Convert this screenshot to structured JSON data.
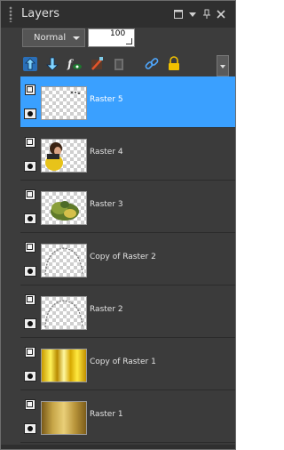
{
  "panel": {
    "title": "Layers"
  },
  "titlebar_icons": [
    "maximize-icon",
    "dropdown-icon",
    "pin-icon",
    "close-icon"
  ],
  "blend_mode": {
    "value": "Normal"
  },
  "opacity": {
    "value": "100"
  },
  "toolbar": {
    "tools": [
      "new-raster-layer-icon",
      "merge-down-icon",
      "fx-effects-icon",
      "edit-layer-icon",
      "mask-icon",
      "link-icon",
      "lock-icon"
    ]
  },
  "layers": [
    {
      "name": "Raster 5",
      "selected": true
    },
    {
      "name": "Raster 4",
      "selected": false
    },
    {
      "name": "Raster 3",
      "selected": false
    },
    {
      "name": "Copy of Raster 2",
      "selected": false
    },
    {
      "name": "Raster 2",
      "selected": false
    },
    {
      "name": "Copy of Raster 1",
      "selected": false
    },
    {
      "name": "Raster 1",
      "selected": false
    }
  ],
  "colors": {
    "selected": "#3aa0ff",
    "panel_bg": "#3c3c3c",
    "titlebar_bg": "#2f2f2f"
  }
}
